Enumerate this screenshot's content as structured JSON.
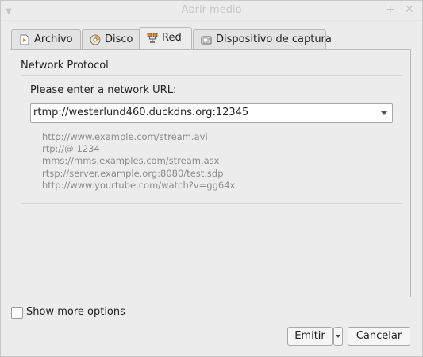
{
  "window": {
    "title": "Abrir medio"
  },
  "tabs": [
    {
      "label": "Archivo",
      "icon": "file-play-icon",
      "accel": "A"
    },
    {
      "label": "Disco",
      "icon": "disc-icon",
      "accel": "D"
    },
    {
      "label": "Red",
      "icon": "network-icon",
      "accel": "R"
    },
    {
      "label": "Dispositivo de captura",
      "icon": "capture-device-icon",
      "accel": "c"
    }
  ],
  "active_tab": "Red",
  "network": {
    "section_label": "Network Protocol",
    "url_label": "Please enter a network URL:",
    "url_value": "rtmp://westerlund460.duckdns.org:12345",
    "examples": [
      "http://www.example.com/stream.avi",
      "rtp://@:1234",
      "mms://mms.examples.com/stream.asx",
      "rtsp://server.example.org:8080/test.sdp",
      "http://www.yourtube.com/watch?v=gg64x"
    ]
  },
  "options": {
    "show_more_label": "Show more options",
    "show_more_checked": false
  },
  "buttons": {
    "play": "Emitir",
    "cancel": "Cancelar"
  },
  "colors": {
    "accent_icon": "#e8862a",
    "window_bg": "#ececec",
    "hint_text": "#8c8c8c"
  }
}
